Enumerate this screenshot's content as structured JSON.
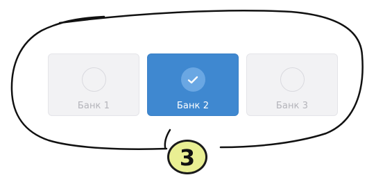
{
  "banks": [
    {
      "label": "Банк 1",
      "selected": false
    },
    {
      "label": "Банк 2",
      "selected": true
    },
    {
      "label": "Банк 3",
      "selected": false
    }
  ],
  "step_marker": {
    "number": "3"
  },
  "colors": {
    "accent": "#3f88d0",
    "accent_light": "#6aa7e3",
    "card_bg": "#f2f2f4",
    "muted_text": "#b4b4ba",
    "marker_fill": "#e9ef93"
  }
}
